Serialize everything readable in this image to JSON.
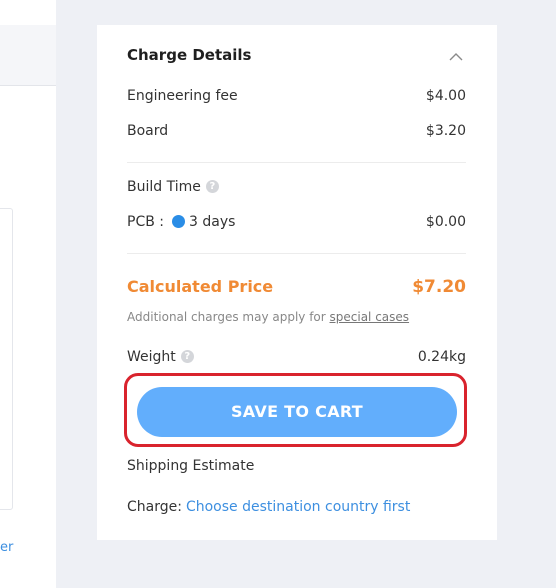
{
  "left_panel": {
    "link_fragment": "er"
  },
  "charge_details": {
    "title": "Charge Details",
    "collapse_icon": "chevron-up-icon",
    "engineering_fee": {
      "label": "Engineering fee",
      "value": "$4.00"
    },
    "board": {
      "label": "Board",
      "value": "$3.20"
    },
    "build_time": {
      "label": "Build Time",
      "help_icon": "question-circle-icon",
      "pcb": {
        "label": "PCB :",
        "option": "3 days",
        "value": "$0.00"
      }
    },
    "calculated_price": {
      "label": "Calculated Price",
      "value": "$7.20"
    },
    "note": {
      "text": "Additional charges may apply for ",
      "link": "special cases"
    },
    "weight": {
      "label": "Weight",
      "value": "0.24kg"
    },
    "save_button": "SAVE TO CART",
    "shipping_estimate": "Shipping Estimate",
    "charge": {
      "label": "Charge:",
      "link": "Choose destination country first"
    }
  },
  "colors": {
    "price": "#f08a34",
    "button": "#62aefc",
    "link": "#3d8fe0",
    "highlight": "#d9232d",
    "radio_dot": "#2a8de6"
  }
}
